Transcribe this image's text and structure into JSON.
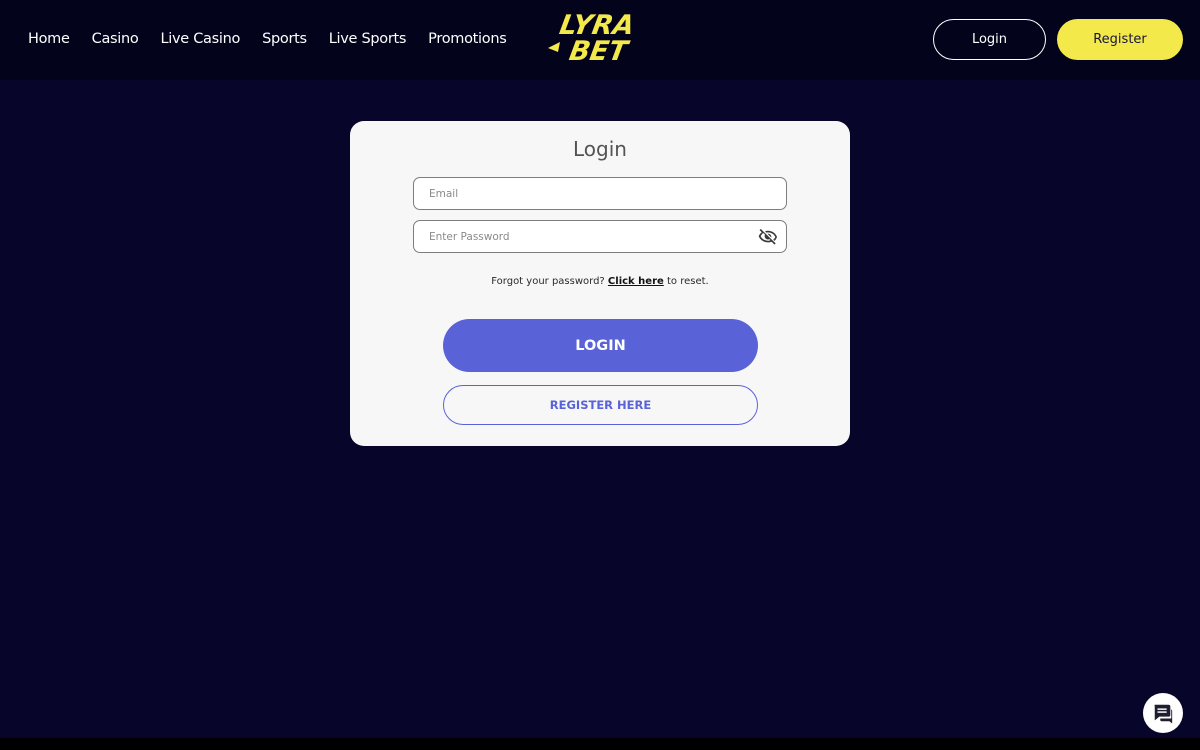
{
  "nav": {
    "items": [
      {
        "label": "Home"
      },
      {
        "label": "Casino"
      },
      {
        "label": "Live Casino"
      },
      {
        "label": "Sports"
      },
      {
        "label": "Live Sports"
      },
      {
        "label": "Promotions"
      }
    ]
  },
  "logo": {
    "line1": "LYRA",
    "line2": "BET"
  },
  "header": {
    "login_label": "Login",
    "register_label": "Register"
  },
  "login_form": {
    "title": "Login",
    "email": {
      "value": "",
      "placeholder": "Email"
    },
    "password": {
      "value": "",
      "placeholder": "Enter Password"
    },
    "forgot_text": "Forgot your password?",
    "forgot_link": "Click here",
    "forgot_suffix": "to reset.",
    "login_button": "LOGIN",
    "register_button": "REGISTER HERE"
  },
  "icons": {
    "password_toggle": "eye-off-icon",
    "chat": "chat-icon"
  },
  "colors": {
    "background": "#07062a",
    "topbar": "#03031c",
    "brand_yellow": "#f4e94b",
    "primary": "#5a62d8",
    "card": "#f7f7f7"
  }
}
